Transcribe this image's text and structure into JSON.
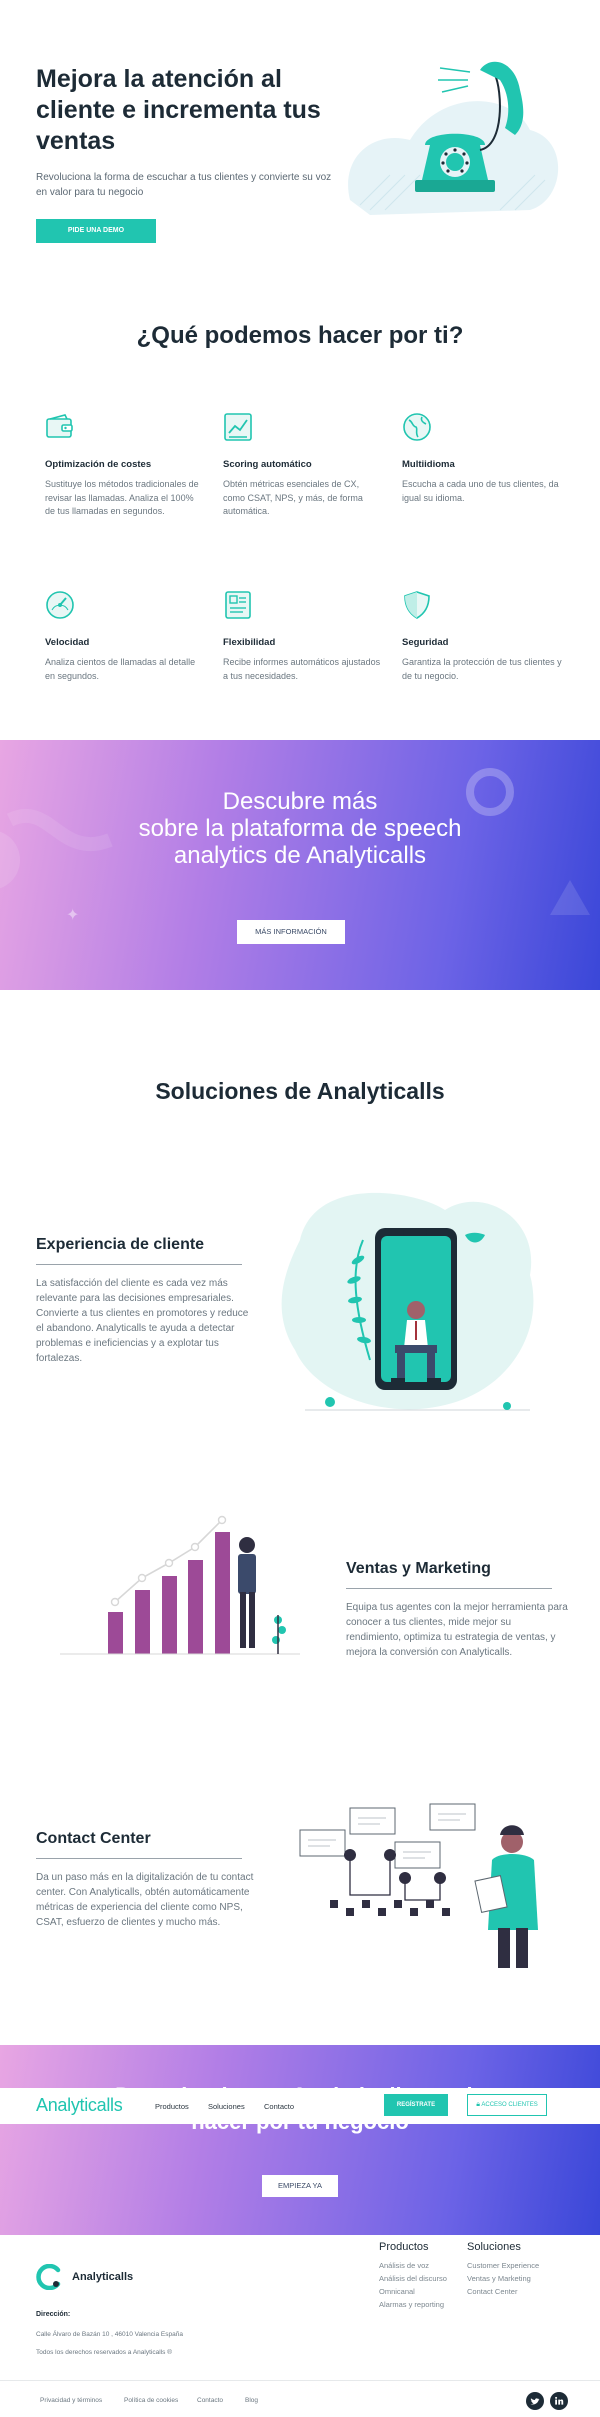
{
  "hero": {
    "title": "Mejora la atención al cliente e incrementa tus ventas",
    "subtitle": "Revoluciona la forma de escuchar a tus clientes y convierte su voz en valor para tu negocio",
    "cta": "PIDE UNA DEMO"
  },
  "features": {
    "title": "¿Qué podemos hacer por ti?",
    "items": [
      {
        "icon": "wallet-icon",
        "title": "Optimización de costes",
        "desc": "Sustituye los métodos tradicionales de revisar las llamadas. Analiza el 100% de tus llamadas en segundos."
      },
      {
        "icon": "chart-icon",
        "title": "Scoring automático",
        "desc": "Obtén métricas esenciales de CX, como CSAT, NPS, y más, de forma automática."
      },
      {
        "icon": "globe-icon",
        "title": "Multiidioma",
        "desc": "Escucha a cada uno de tus clientes, da igual su idioma."
      },
      {
        "icon": "speedometer-icon",
        "title": "Velocidad",
        "desc": "Analiza cientos de llamadas al detalle en segundos."
      },
      {
        "icon": "report-icon",
        "title": "Flexibilidad",
        "desc": "Recibe informes automáticos ajustados a tus necesidades."
      },
      {
        "icon": "shield-icon",
        "title": "Seguridad",
        "desc": "Garantiza la protección de tus clientes y de tu negocio."
      }
    ]
  },
  "banner": {
    "line1": "Descubre más",
    "line2": "sobre la plataforma de speech",
    "line3": "analytics de Analyticalls",
    "cta": "MÁS INFORMACIÓN"
  },
  "solutions": {
    "title": "Soluciones de Analyticalls",
    "items": [
      {
        "title": "Experiencia de cliente",
        "desc": "La satisfacción del cliente es cada vez más relevante para las decisiones empresariales. Convierte a tus clientes en promotores y reduce el abandono. Analyticalls te ayuda a detectar problemas e ineficiencias y a explotar tus fortalezas."
      },
      {
        "title": "Ventas y Marketing",
        "desc": "Equipa tus agentes con la mejor herramienta para conocer a tus clientes, mide mejor su rendimiento, optimiza tu estrategia de ventas, y mejora la conversión con Analyticalls."
      },
      {
        "title": "Contact Center",
        "desc": "Da un paso más en la digitalización de tu contact center. Con Analyticalls, obtén automáticamente métricas de experiencia del cliente como NPS, CSAT, esfuerzo de clientes y mucho más."
      }
    ]
  },
  "bottom_banner": {
    "line1": "Descubre lo que Analyticalls puede",
    "line2": "hacer por tu negocio",
    "cta": "EMPIEZA YA"
  },
  "navbar": {
    "logo": "Analyticalls",
    "links": [
      "Productos",
      "Soluciones",
      "Contacto"
    ],
    "register": "REGÍSTRATE",
    "access": "ACCESO CLIENTES"
  },
  "footer": {
    "brand": "Analyticalls",
    "address_label": "Dirección:",
    "address": "Calle Álvaro de Bazán 10 , 46010 Valencia España",
    "rights": "Todos los derechos reservados a Analyticalls ®",
    "col1": {
      "title": "Productos",
      "links": [
        "Análisis de voz",
        "Análisis del discurso",
        "Omnicanal",
        "Alarmas y reporting"
      ]
    },
    "col2": {
      "title": "Soluciones",
      "links": [
        "Customer Experience",
        "Ventas y Marketing",
        "Contact Center"
      ]
    },
    "bottom_links": [
      "Privacidad y términos",
      "Política de cookies",
      "Contacto",
      "Blog"
    ],
    "social": [
      "twitter-icon",
      "linkedin-icon"
    ]
  },
  "colors": {
    "accent": "#21c5b0",
    "dark": "#1d2b36",
    "purple": "#9d4a97"
  }
}
